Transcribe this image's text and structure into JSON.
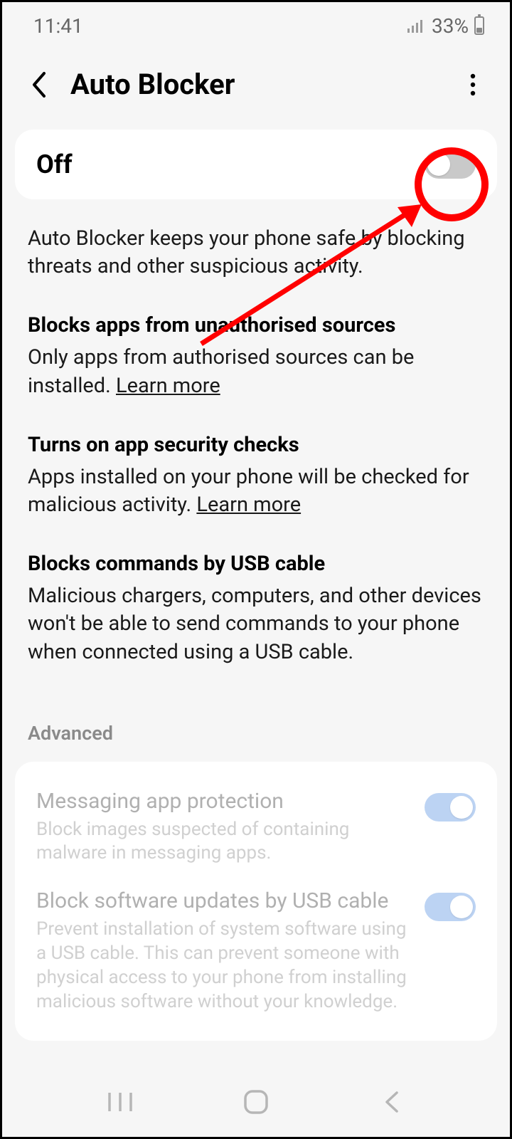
{
  "status": {
    "time": "11:41",
    "battery_percent": "33%"
  },
  "header": {
    "title": "Auto Blocker"
  },
  "master": {
    "label": "Off",
    "state": "off"
  },
  "intro": "Auto Blocker keeps your phone safe by blocking threats and other suspicious activity.",
  "sections": {
    "s1": {
      "title": "Blocks apps from unauthorised sources",
      "body": "Only apps from authorised sources can be installed.",
      "link": "Learn more"
    },
    "s2": {
      "title": "Turns on app security checks",
      "body": "Apps installed on your phone will be checked for malicious activity.",
      "link": "Learn more"
    },
    "s3": {
      "title": "Blocks commands by USB cable",
      "body": "Malicious chargers, computers, and other devices won't be able to send commands to your phone when connected using a USB cable."
    }
  },
  "advanced": {
    "label": "Advanced",
    "items": {
      "a1": {
        "title": "Messaging app protection",
        "desc": "Block images suspected of containing malware in messaging apps.",
        "state": "on"
      },
      "a2": {
        "title": "Block software updates by USB cable",
        "desc": "Prevent installation of system software using a USB cable. This can prevent someone with physical access to your phone from installing malicious software without your knowledge.",
        "state": "on"
      }
    }
  },
  "annotation": {
    "highlight_color": "#ff0000"
  }
}
